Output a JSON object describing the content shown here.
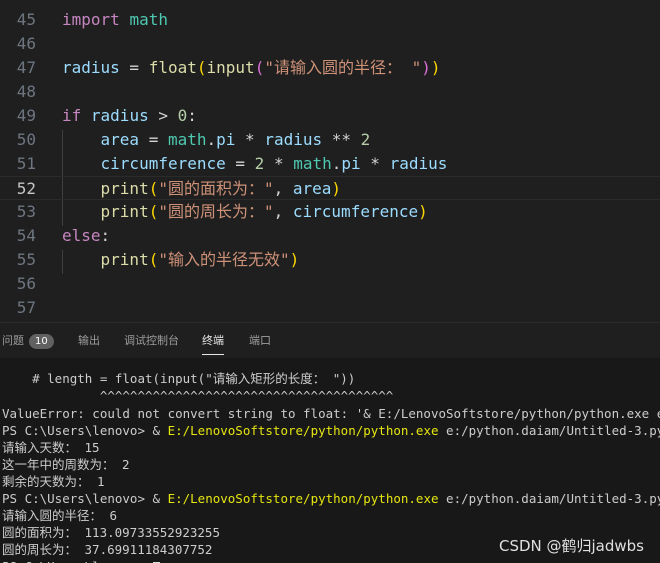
{
  "editor": {
    "lines": [
      {
        "n": "45",
        "tokens": [
          [
            "kw",
            "import"
          ],
          [
            "op",
            " "
          ],
          [
            "mod",
            "math"
          ]
        ]
      },
      {
        "n": "46",
        "tokens": []
      },
      {
        "n": "47",
        "tokens": [
          [
            "var",
            "radius"
          ],
          [
            "op",
            " = "
          ],
          [
            "fn",
            "float"
          ],
          [
            "p1",
            "("
          ],
          [
            "fn",
            "input"
          ],
          [
            "p2",
            "("
          ],
          [
            "str",
            "\"请输入圆的半径： \""
          ],
          [
            "p2",
            ")"
          ],
          [
            "p1",
            ")"
          ]
        ]
      },
      {
        "n": "48",
        "tokens": []
      },
      {
        "n": "49",
        "tokens": [
          [
            "kw",
            "if"
          ],
          [
            "op",
            " "
          ],
          [
            "var",
            "radius"
          ],
          [
            "op",
            " > "
          ],
          [
            "num",
            "0"
          ],
          [
            "op",
            ":"
          ]
        ]
      },
      {
        "n": "50",
        "tokens": [
          [
            "op",
            "    "
          ],
          [
            "var",
            "area"
          ],
          [
            "op",
            " = "
          ],
          [
            "mod",
            "math"
          ],
          [
            "op",
            "."
          ],
          [
            "var",
            "pi"
          ],
          [
            "op",
            " * "
          ],
          [
            "var",
            "radius"
          ],
          [
            "op",
            " ** "
          ],
          [
            "num",
            "2"
          ]
        ]
      },
      {
        "n": "51",
        "tokens": [
          [
            "op",
            "    "
          ],
          [
            "var",
            "circumference"
          ],
          [
            "op",
            " = "
          ],
          [
            "num",
            "2"
          ],
          [
            "op",
            " * "
          ],
          [
            "mod",
            "math"
          ],
          [
            "op",
            "."
          ],
          [
            "var",
            "pi"
          ],
          [
            "op",
            " * "
          ],
          [
            "var",
            "radius"
          ]
        ]
      },
      {
        "n": "52",
        "tokens": [
          [
            "op",
            "    "
          ],
          [
            "fn",
            "print"
          ],
          [
            "p1",
            "("
          ],
          [
            "str",
            "\"圆的面积为：\""
          ],
          [
            "op",
            ", "
          ],
          [
            "var",
            "area"
          ],
          [
            "p1",
            ")"
          ]
        ]
      },
      {
        "n": "53",
        "tokens": [
          [
            "op",
            "    "
          ],
          [
            "fn",
            "print"
          ],
          [
            "p1",
            "("
          ],
          [
            "str",
            "\"圆的周长为：\""
          ],
          [
            "op",
            ", "
          ],
          [
            "var",
            "circumference"
          ],
          [
            "p1",
            ")"
          ]
        ]
      },
      {
        "n": "54",
        "tokens": [
          [
            "kw",
            "else"
          ],
          [
            "op",
            ":"
          ]
        ]
      },
      {
        "n": "55",
        "tokens": [
          [
            "op",
            "    "
          ],
          [
            "fn",
            "print"
          ],
          [
            "p1",
            "("
          ],
          [
            "str",
            "\"输入的半径无效\""
          ],
          [
            "p1",
            ")"
          ]
        ]
      },
      {
        "n": "56",
        "tokens": []
      },
      {
        "n": "57",
        "tokens": []
      }
    ]
  },
  "panel": {
    "tabs": [
      {
        "label": "问题",
        "badge": "10"
      },
      {
        "label": "输出"
      },
      {
        "label": "调试控制台"
      },
      {
        "label": "终端"
      },
      {
        "label": "端口"
      }
    ]
  },
  "terminal": {
    "lines": [
      [
        [
          "n",
          "    # length = float(input(\"请输入矩形的长度： \"))"
        ]
      ],
      [
        [
          "n",
          "             ^^^^^^^^^^^^^^^^^^^^^^^^^^^^^^^^^^^^^^^"
        ]
      ],
      [
        [
          "n",
          "ValueError: could not convert string to float: '& E:/LenovoSoftstore/python/python.exe e:/pyth"
        ]
      ],
      [
        [
          "n",
          "PS C:\\Users\\lenovo> & "
        ],
        [
          "y",
          "E:/LenovoSoftstore/python/python.exe"
        ],
        [
          "n",
          " e:/python.daiam/Untitled-3.py"
        ]
      ],
      [
        [
          "n",
          "请输入天数： 15"
        ]
      ],
      [
        [
          "n",
          "这一年中的周数为： 2"
        ]
      ],
      [
        [
          "n",
          "剩余的天数为： 1"
        ]
      ],
      [
        [
          "n",
          "PS C:\\Users\\lenovo> & "
        ],
        [
          "y",
          "E:/LenovoSoftstore/python/python.exe"
        ],
        [
          "n",
          " e:/python.daiam/Untitled-3.py"
        ]
      ],
      [
        [
          "n",
          "请输入圆的半径： 6"
        ]
      ],
      [
        [
          "n",
          "圆的面积为： 113.09733552923255"
        ]
      ],
      [
        [
          "n",
          "圆的周长为： 37.69911184307752"
        ]
      ],
      [
        [
          "n",
          "PS C:\\Users\\lenovo> "
        ]
      ]
    ]
  },
  "watermark": "CSDN @鹤归jadwbs"
}
